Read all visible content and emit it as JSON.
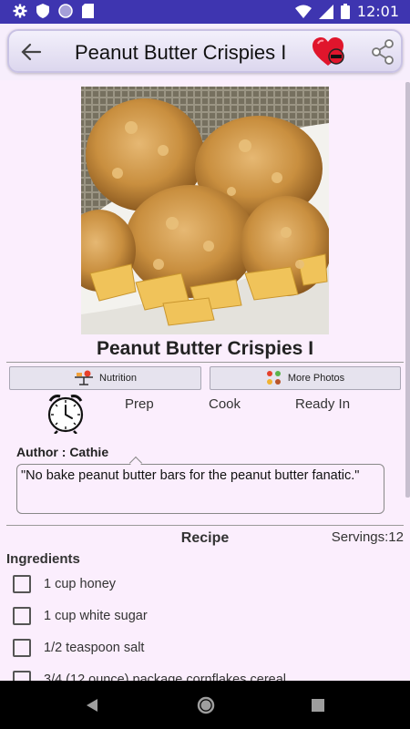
{
  "status": {
    "time": "12:01"
  },
  "toolbar": {
    "title": "Peanut Butter Crispies I"
  },
  "recipe": {
    "name": "Peanut Butter Crispies I",
    "nutrition_label": "Nutrition",
    "more_photos_label": "More Photos",
    "prep_label": "Prep",
    "cook_label": "Cook",
    "ready_label": "Ready In",
    "author": "Author : Cathie",
    "description": "\"No bake peanut butter bars for the peanut butter fanatic.\"",
    "section_title": "Recipe",
    "servings": "Servings:12",
    "ingredients_heading": "Ingredients",
    "ingredients": [
      "1 cup honey",
      "1 cup white sugar",
      "1/2 teaspoon salt",
      "3/4 (12 ounce) package cornflakes cereal"
    ]
  },
  "colors": {
    "status_bar": "#3e35b0",
    "background": "#fbeefd",
    "favorite": "#e0152c"
  }
}
